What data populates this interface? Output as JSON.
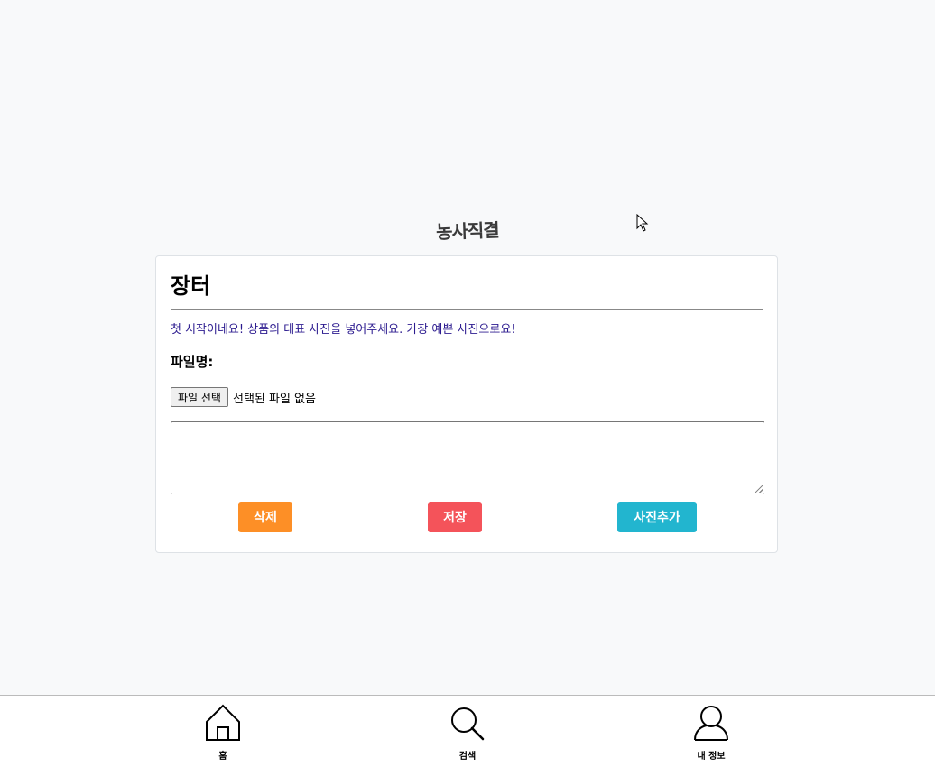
{
  "logo": {
    "text": "농사직결"
  },
  "card": {
    "title": "장터",
    "guide_text": "첫 시작이네요! 상품의 대표 사진을 넣어주세요. 가장 예쁜 사진으로요!",
    "file_label": "파일명:",
    "file_button_label": "파일 선택",
    "file_status": "선택된 파일 없음",
    "textarea_value": ""
  },
  "actions": {
    "delete_label": "삭제",
    "save_label": "저장",
    "add_photo_label": "사진추가"
  },
  "bottom_nav": {
    "items": [
      {
        "label": "홈",
        "icon": "home-icon"
      },
      {
        "label": "검색",
        "icon": "search-icon"
      },
      {
        "label": "내 정보",
        "icon": "user-icon"
      }
    ]
  },
  "colors": {
    "delete": "#fd8f26",
    "save": "#f4535a",
    "add_photo": "#22b5cf",
    "guide_text": "#2c1b8f",
    "background": "#f8f9fa"
  }
}
